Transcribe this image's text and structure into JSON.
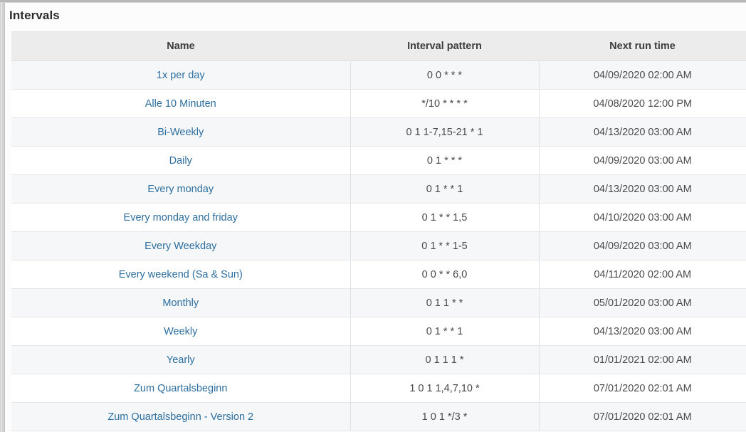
{
  "panel": {
    "title": "Intervals"
  },
  "table": {
    "columns": [
      {
        "key": "name",
        "label": "Name"
      },
      {
        "key": "pattern",
        "label": "Interval pattern"
      },
      {
        "key": "next",
        "label": "Next run time"
      }
    ],
    "rows": [
      {
        "name": "1x per day",
        "pattern": "0 0 * * *",
        "next": "04/09/2020 02:00 AM"
      },
      {
        "name": "Alle 10 Minuten",
        "pattern": "*/10 * * * *",
        "next": "04/08/2020 12:00 PM"
      },
      {
        "name": "Bi-Weekly",
        "pattern": "0 1 1-7,15-21 * 1",
        "next": "04/13/2020 03:00 AM"
      },
      {
        "name": "Daily",
        "pattern": "0 1 * * *",
        "next": "04/09/2020 03:00 AM"
      },
      {
        "name": "Every monday",
        "pattern": "0 1 * * 1",
        "next": "04/13/2020 03:00 AM"
      },
      {
        "name": "Every monday and friday",
        "pattern": "0 1 * * 1,5",
        "next": "04/10/2020 03:00 AM"
      },
      {
        "name": "Every Weekday",
        "pattern": "0 1 * * 1-5",
        "next": "04/09/2020 03:00 AM"
      },
      {
        "name": "Every weekend (Sa & Sun)",
        "pattern": "0 0 * * 6,0",
        "next": "04/11/2020 02:00 AM"
      },
      {
        "name": "Monthly",
        "pattern": "0 1 1 * *",
        "next": "05/01/2020 03:00 AM"
      },
      {
        "name": "Weekly",
        "pattern": "0 1 * * 1",
        "next": "04/13/2020 03:00 AM"
      },
      {
        "name": "Yearly",
        "pattern": "0 1 1 1 *",
        "next": "01/01/2021 02:00 AM"
      },
      {
        "name": "Zum Quartalsbeginn",
        "pattern": "1 0 1 1,4,7,10 *",
        "next": "07/01/2020 02:01 AM"
      },
      {
        "name": "Zum Quartalsbeginn - Version 2",
        "pattern": "1 0 1 */3 *",
        "next": "07/01/2020 02:01 AM"
      }
    ]
  },
  "colors": {
    "link": "#2d6e9e",
    "header_bg": "#ececec",
    "row_odd_bg": "#f5f7f9",
    "row_even_bg": "#ffffff",
    "text": "#4a4a4a"
  }
}
